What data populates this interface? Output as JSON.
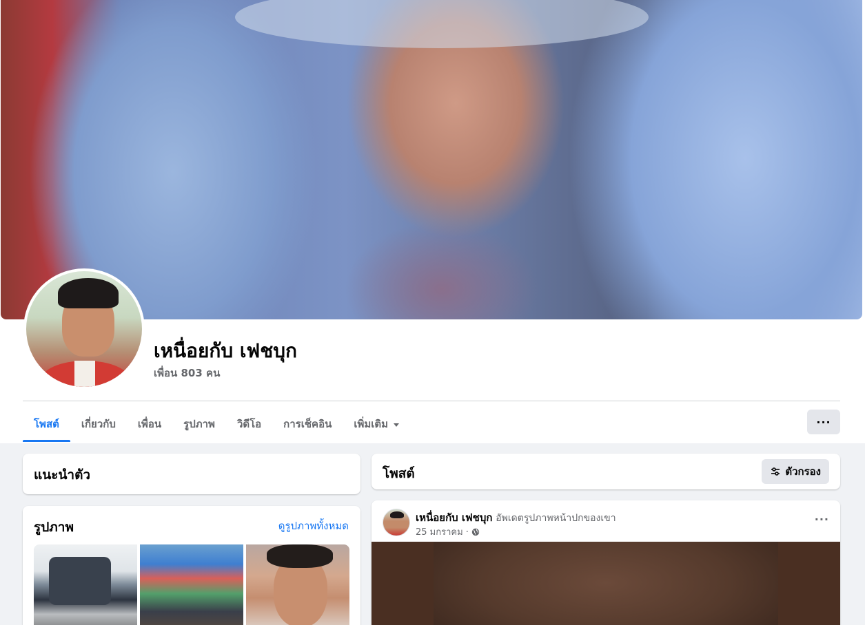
{
  "profile": {
    "name": "เหนื่อยกับ เฟชบุก",
    "friends": "เพื่อน 803 คน"
  },
  "tabs": [
    {
      "label": "โพสต์",
      "active": true
    },
    {
      "label": "เกี่ยวกับ",
      "active": false
    },
    {
      "label": "เพื่อน",
      "active": false
    },
    {
      "label": "รูปภาพ",
      "active": false
    },
    {
      "label": "วิดีโอ",
      "active": false
    },
    {
      "label": "การเช็คอิน",
      "active": false
    },
    {
      "label": "เพิ่มเติม",
      "active": false
    }
  ],
  "more_menu_label": "···",
  "intro": {
    "title": "แนะนำตัว"
  },
  "photos": {
    "title": "รูปภาพ",
    "see_all": "ดูรูปภาพทั้งหมด"
  },
  "posts": {
    "title": "โพสต์",
    "filter_label": "ตัวกรอง"
  },
  "post": {
    "author": "เหนื่อยกับ เฟชบุก",
    "action": "อัพเดตรูปภาพหน้าปกของเขา",
    "date": "25 มกราคม ·",
    "more": "···"
  },
  "colors": {
    "accent": "#1877f2",
    "secondary_text": "#65676b",
    "background": "#f0f2f5",
    "button_bg": "#e4e6eb"
  },
  "icons": {
    "filter": "sliders-icon",
    "privacy": "globe-icon",
    "dropdown": "caret-down-icon",
    "more": "ellipsis-icon"
  }
}
